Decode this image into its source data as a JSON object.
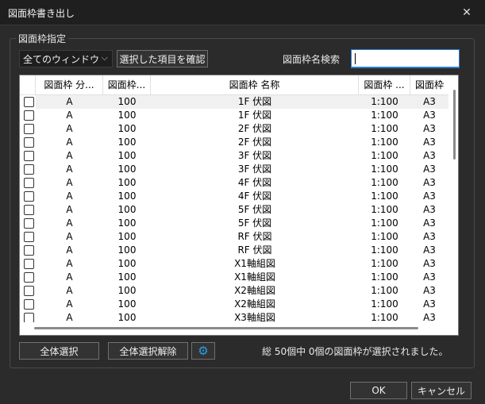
{
  "window": {
    "title": "図面枠書き出し",
    "close_glyph": "✕"
  },
  "group": {
    "legend": "図面枠指定"
  },
  "filter": {
    "selected": "全てのウィンドウ",
    "chevron_glyph": "⌵"
  },
  "toolbar": {
    "confirm_label": "選択した項目を確認"
  },
  "search": {
    "label": "図面枠名検索",
    "value": ""
  },
  "grid": {
    "columns": [
      "図面枠 分...",
      "図面枠...",
      "図面枠 名称",
      "図面枠 ...",
      "図面枠"
    ],
    "rows": [
      {
        "cat": "A",
        "num": "100",
        "name": "1F 伏図",
        "scale": "1:100",
        "size": "A3"
      },
      {
        "cat": "A",
        "num": "100",
        "name": "1F 伏図",
        "scale": "1:100",
        "size": "A3"
      },
      {
        "cat": "A",
        "num": "100",
        "name": "2F 伏図",
        "scale": "1:100",
        "size": "A3"
      },
      {
        "cat": "A",
        "num": "100",
        "name": "2F 伏図",
        "scale": "1:100",
        "size": "A3"
      },
      {
        "cat": "A",
        "num": "100",
        "name": "3F 伏図",
        "scale": "1:100",
        "size": "A3"
      },
      {
        "cat": "A",
        "num": "100",
        "name": "3F 伏図",
        "scale": "1:100",
        "size": "A3"
      },
      {
        "cat": "A",
        "num": "100",
        "name": "4F 伏図",
        "scale": "1:100",
        "size": "A3"
      },
      {
        "cat": "A",
        "num": "100",
        "name": "4F 伏図",
        "scale": "1:100",
        "size": "A3"
      },
      {
        "cat": "A",
        "num": "100",
        "name": "5F 伏図",
        "scale": "1:100",
        "size": "A3"
      },
      {
        "cat": "A",
        "num": "100",
        "name": "5F 伏図",
        "scale": "1:100",
        "size": "A3"
      },
      {
        "cat": "A",
        "num": "100",
        "name": "RF 伏図",
        "scale": "1:100",
        "size": "A3"
      },
      {
        "cat": "A",
        "num": "100",
        "name": "RF 伏図",
        "scale": "1:100",
        "size": "A3"
      },
      {
        "cat": "A",
        "num": "100",
        "name": "X1軸組図",
        "scale": "1:100",
        "size": "A3"
      },
      {
        "cat": "A",
        "num": "100",
        "name": "X1軸組図",
        "scale": "1:100",
        "size": "A3"
      },
      {
        "cat": "A",
        "num": "100",
        "name": "X2軸組図",
        "scale": "1:100",
        "size": "A3"
      },
      {
        "cat": "A",
        "num": "100",
        "name": "X2軸組図",
        "scale": "1:100",
        "size": "A3"
      },
      {
        "cat": "A",
        "num": "100",
        "name": "X3軸組図",
        "scale": "1:100",
        "size": "A3"
      }
    ]
  },
  "footer": {
    "select_all": "全体選択",
    "deselect_all": "全体選択解除",
    "settings_icon": "gear-icon",
    "settings_glyph": "⚙",
    "status": "総 50個中 0個の図面枠が選択されました。"
  },
  "dialog": {
    "ok": "OK",
    "cancel": "キャンセル"
  },
  "colors": {
    "accent": "#2b7fd4",
    "gear": "#2aa0e8",
    "background": "#2b2b2b"
  }
}
